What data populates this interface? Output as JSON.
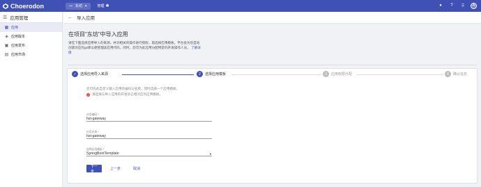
{
  "app": {
    "brand": "Choerodon",
    "project": "东坊",
    "manage_label": "管理"
  },
  "colors": {
    "primary": "#3f51b5",
    "warning": "#f44336"
  },
  "sidebar": {
    "title": "应用管理",
    "items": [
      {
        "label": "应用",
        "icon": "grid-icon",
        "active": true
      },
      {
        "label": "应用版本",
        "icon": "version-icon",
        "active": false
      },
      {
        "label": "应用发布",
        "icon": "publish-icon",
        "active": false
      },
      {
        "label": "应用市场",
        "icon": "market-icon",
        "active": false
      }
    ]
  },
  "header": {
    "title": "导入应用"
  },
  "page": {
    "heading": "在项目\"东坊\"中导入应用",
    "description": "请在下面选择应用导入的来源，并对相关的操作进行授权，再选择应用模板，平台会为您自动创建对应的git库以便管理该应用代码，同时，您可为此应用分配特定的开发操作人员。",
    "learn_more": "了解详情"
  },
  "steps": [
    {
      "num": "✓",
      "label": "选择应用导入来源",
      "state": "done"
    },
    {
      "num": "2",
      "label": "选择应用模板",
      "state": "active"
    },
    {
      "num": "3",
      "label": "应用权限分配",
      "state": "todo"
    },
    {
      "num": "4",
      "label": "确认信息",
      "state": "todo"
    }
  ],
  "form": {
    "hint": "您可在此自定义输入应用的编码与名称，同时选择一个应用模板。",
    "warning": "请选择与导入应用的开发语言相对应的应用模板。",
    "code_label": "应用编码 *",
    "code_value": "hst-gateway",
    "name_label": "应用名称 *",
    "name_value": "hst-gateway",
    "template_label": "选择应用模板 *",
    "template_value": "SpringBootTemplate",
    "next_button": "下一步",
    "prev_button": "上一步",
    "cancel_button": "取消"
  }
}
